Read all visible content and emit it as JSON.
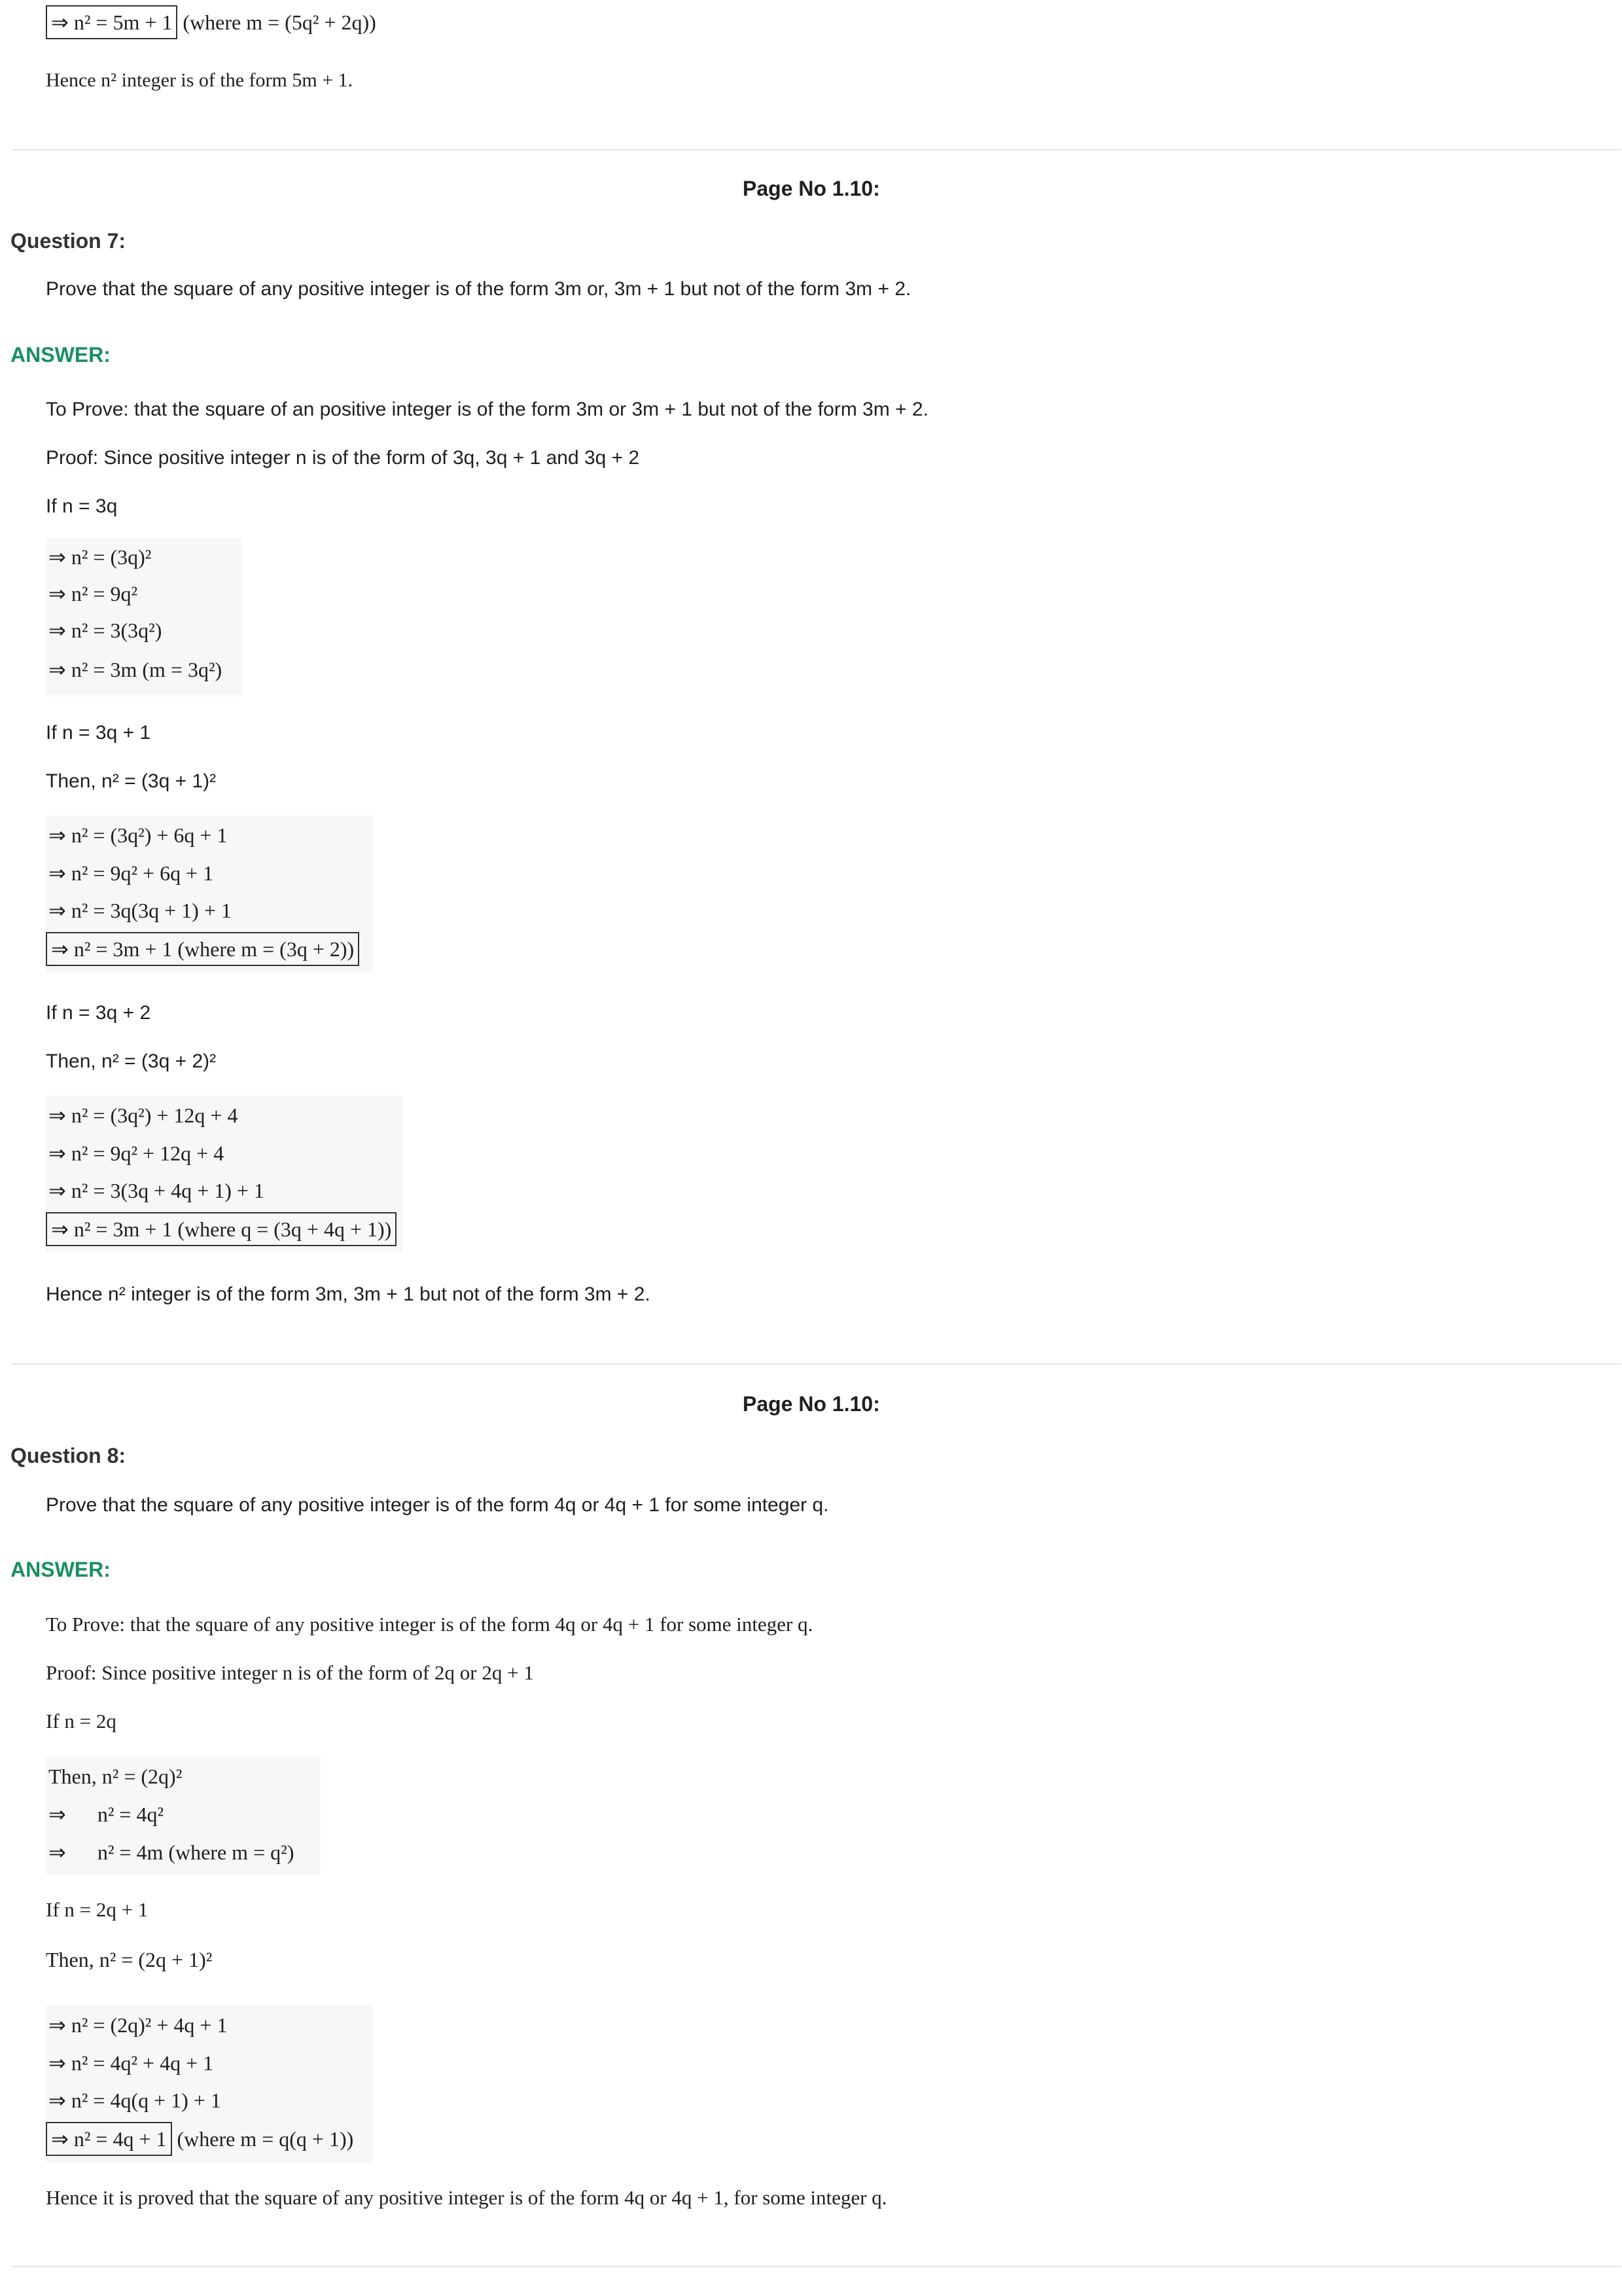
{
  "top": {
    "boxed": "⇒ n² = 5m + 1",
    "where": "(where m = (5q² + 2q))",
    "hence": "Hence n² integer is of the form 5m + 1."
  },
  "q7": {
    "page_no": "Page No 1.10:",
    "question_label": "Question 7:",
    "question": "Prove that the square of any positive integer is of the form 3m or, 3m + 1 but not of the form 3m + 2.",
    "answer_label": "ANSWER:",
    "to_prove": "To Prove: that the square of an positive integer is of the form 3m or 3m + 1 but not of the form 3m + 2.",
    "proof": "Proof: Since positive integer n is of the form of 3q, 3q + 1 and 3q + 2",
    "case1": "If n = 3q",
    "case1_lines": [
      "⇒ n² = (3q)²",
      "⇒ n² = 9q²",
      "⇒ n² = 3(3q²)",
      "⇒ n² = 3m (m = 3q²)"
    ],
    "case2": "If n = 3q + 1",
    "case2_then": "Then, n² = (3q + 1)²",
    "case2_lines": [
      "⇒ n² = (3q²) + 6q + 1",
      "⇒ n² = 9q² + 6q + 1",
      "⇒ n² = 3q(3q + 1) + 1"
    ],
    "case2_boxed": "⇒ n² = 3m + 1 (where m = (3q + 2))",
    "case3": "If n = 3q + 2",
    "case3_then": "Then, n² = (3q + 2)²",
    "case3_lines": [
      "⇒ n² = (3q²) + 12q + 4",
      "⇒ n² = 9q² + 12q + 4",
      "⇒ n² = 3(3q + 4q + 1) + 1"
    ],
    "case3_boxed": "⇒ n² = 3m + 1 (where q = (3q + 4q + 1))",
    "hence": "Hence n² integer is of the form 3m, 3m + 1 but not of the form 3m + 2."
  },
  "q8": {
    "page_no": "Page No 1.10:",
    "question_label": "Question 8:",
    "question": "Prove that the square of any positive integer is of the form 4q or 4q + 1 for some integer q.",
    "answer_label": "ANSWER:",
    "to_prove": "To Prove: that the square of any positive integer is of the form 4q or 4q + 1 for some integer q.",
    "proof": "Proof: Since positive integer n is of the form of 2q or 2q + 1",
    "case1": "If n = 2q",
    "case1_lines": [
      "Then, n² = (2q)²",
      "⇒      n² = 4q²",
      "⇒      n² = 4m (where m = q²)"
    ],
    "case2": "If n = 2q + 1",
    "case2_then": "Then, n² = (2q + 1)²",
    "case2_lines": [
      "⇒ n² = (2q)² + 4q + 1",
      "⇒ n² = 4q² + 4q + 1",
      "⇒ n² = 4q(q + 1) + 1"
    ],
    "case2_boxed": "⇒ n² = 4q + 1",
    "case2_where": "(where m = q(q + 1))",
    "hence": "Hence it is proved that the square of any positive integer is of the form 4q or 4q + 1, for some integer q."
  }
}
